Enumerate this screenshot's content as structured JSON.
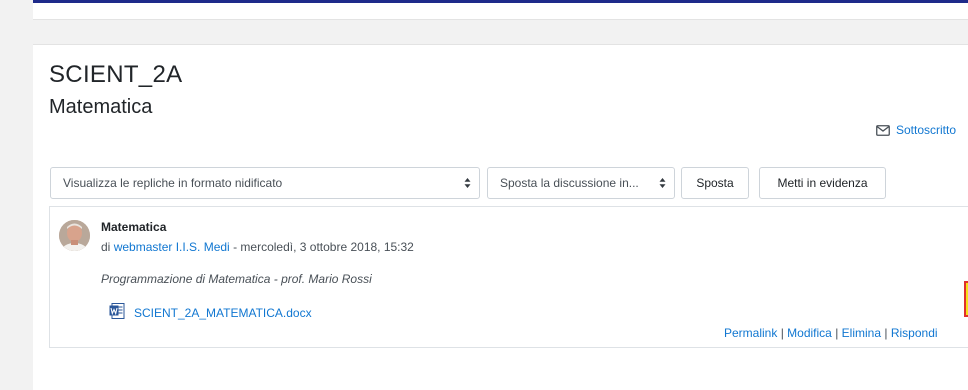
{
  "header": {
    "course_name": "SCIENT_2A",
    "forum_name": "Matematica"
  },
  "subscription": {
    "label": "Sottoscritto",
    "icon": "envelope-icon"
  },
  "controls": {
    "display_mode": "Visualizza le repliche in formato nidificato",
    "move_select": "Sposta la discussione in...",
    "move_button": "Sposta",
    "pin_button": "Metti in evidenza"
  },
  "post": {
    "subject": "Matematica",
    "by_prefix": "di",
    "author": "webmaster I.I.S. Medi",
    "date": "- mercoledì, 3 ottobre 2018, 15:32",
    "message": "Programmazione di Matematica - prof. Mario Rossi",
    "attachment": {
      "name": "SCIENT_2A_MATEMATICA.docx",
      "icon": "word-document-icon"
    },
    "commands": {
      "permalink": "Permalink",
      "edit": "Modifica",
      "delete": "Elimina",
      "reply": "Rispondi",
      "separator": "|"
    }
  },
  "colors": {
    "navbar": "#1e2a8a",
    "link": "#1177d1",
    "page_bg": "#f2f2f2"
  }
}
